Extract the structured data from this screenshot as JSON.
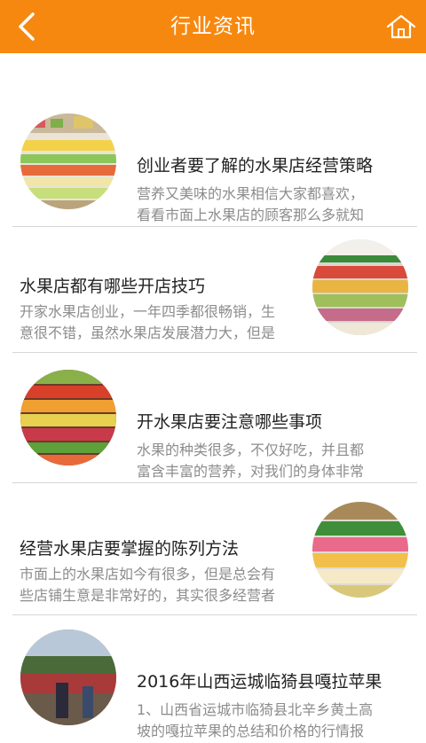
{
  "header": {
    "title": "行业资讯",
    "back_icon": "back-chevron-icon",
    "home_icon": "home-icon",
    "background": "#f7880f"
  },
  "articles": [
    {
      "title": "创业者要了解的水果店经营策略",
      "summary_line1": "营养又美味的水果相信大家都喜欢，",
      "summary_line2": "看看市面上水果店的顾客那么多就知",
      "image_side": "left"
    },
    {
      "title": "水果店都有哪些开店技巧",
      "summary_line1": "开家水果店创业，一年四季都很畅销，生",
      "summary_line2": "意很不错，虽然水果店发展潜力大，但是",
      "image_side": "right"
    },
    {
      "title": "开水果店要注意哪些事项",
      "summary_line1": "水果的种类很多，不仅好吃，并且都",
      "summary_line2": "富含丰富的营养，对我们的身体非常",
      "image_side": "left"
    },
    {
      "title": "经营水果店要掌握的陈列方法",
      "summary_line1": "市面上的水果店如今有很多，但是总会有",
      "summary_line2": "些店铺生意是非常好的，其实很多经营者",
      "image_side": "right"
    },
    {
      "title": "2016年山西运城临猗县嘎拉苹果",
      "summary_line1": "1、山西省运城市临猗县北辛乡黄土高",
      "summary_line2": "坡的嘎拉苹果的总结和价格的行情报",
      "image_side": "left"
    }
  ]
}
